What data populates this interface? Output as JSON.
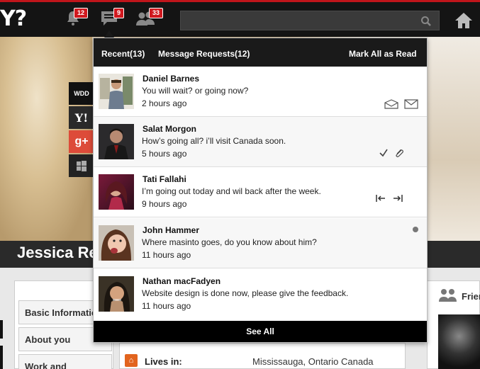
{
  "header": {
    "logo": "Y?",
    "notifications_count": "12",
    "messages_count": "9",
    "friend_requests_count": "33",
    "search_placeholder": ""
  },
  "profile": {
    "name": "Jessica Re",
    "social": [
      "WDD",
      "Y!",
      "g+",
      "windows"
    ],
    "sidebar": [
      "Basic Information",
      "About you",
      "Work and"
    ],
    "lives_in_label": "Lives in:",
    "lives_in_value": "Mississauga, Ontario Canada",
    "friends_label": "Frien"
  },
  "dropdown": {
    "tabs": {
      "recent": "Recent(13)",
      "requests": "Message Requests(12)",
      "mark_read": "Mark All as Read"
    },
    "messages": [
      {
        "name": "Daniel Barnes",
        "text": "You will wait? or going now?",
        "time": "2 hours ago"
      },
      {
        "name": "Salat Morgon",
        "text": "How’s going all? i’ll visit Canada soon.",
        "time": "5 hours ago"
      },
      {
        "name": "Tati Fallahi",
        "text": "I’m going out today and wil back after the week.",
        "time": "9 hours ago"
      },
      {
        "name": "John Hammer",
        "text": "Where masinto goes, do you know about him?",
        "time": "11 hours ago"
      },
      {
        "name": "Nathan macFadyen",
        "text": "Website design is done now, please give the feedback.",
        "time": "11 hours ago"
      }
    ],
    "see_all": "See All"
  },
  "colors": {
    "accent": "#d0191f",
    "topbar": "#141414",
    "dropdown_header": "#1a1a1a"
  }
}
